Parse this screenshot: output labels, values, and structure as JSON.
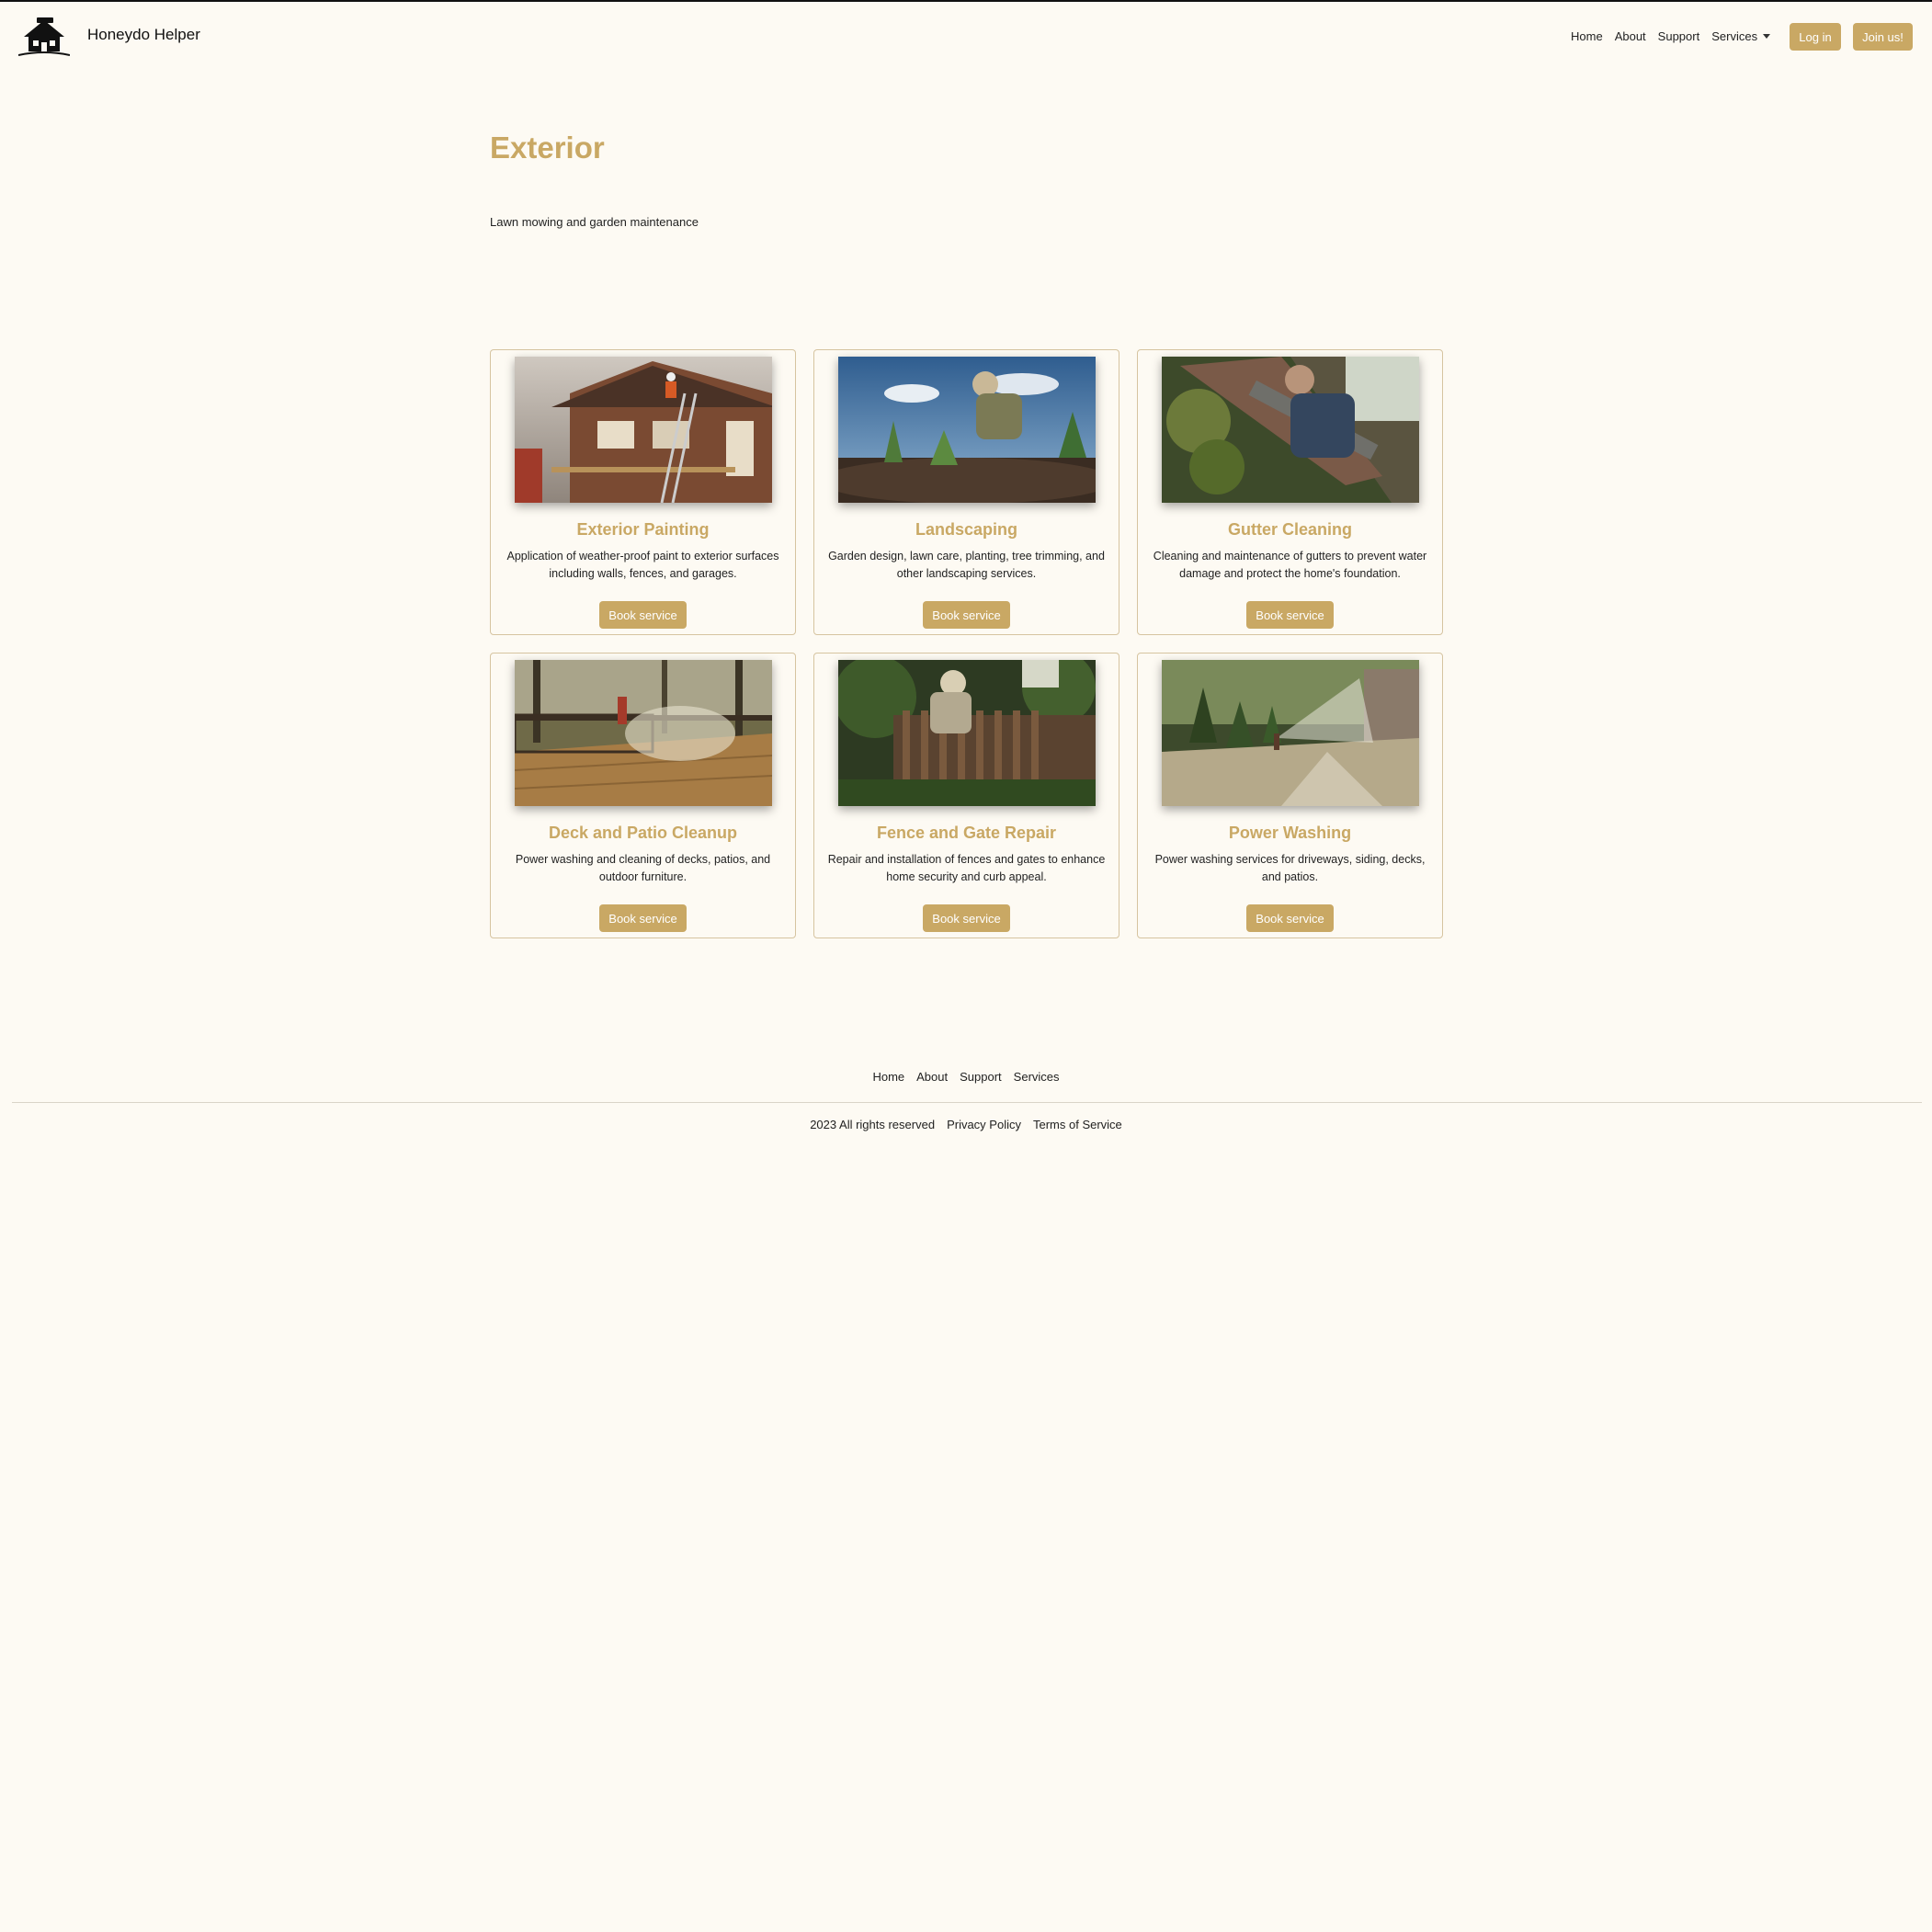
{
  "brand": {
    "name": "Honeydo Helper",
    "logo_icon": "house-with-hammer-icon"
  },
  "nav": {
    "links": [
      "Home",
      "About",
      "Support",
      "Services"
    ],
    "login_label": "Log in",
    "join_label": "Join us!"
  },
  "page": {
    "title": "Exterior",
    "subtitle": "Lawn mowing and garden maintenance"
  },
  "cards": [
    {
      "title": "Exterior Painting",
      "description": "Application of weather-proof paint to exterior surfaces including walls, fences, and garages.",
      "button": "Book service"
    },
    {
      "title": "Landscaping",
      "description": "Garden design, lawn care, planting, tree trimming, and other landscaping services.",
      "button": "Book service"
    },
    {
      "title": "Gutter Cleaning",
      "description": "Cleaning and maintenance of gutters to prevent water damage and protect the home's foundation.",
      "button": "Book service"
    },
    {
      "title": "Deck and Patio Cleanup",
      "description": "Power washing and cleaning of decks, patios, and outdoor furniture.",
      "button": "Book service"
    },
    {
      "title": "Fence and Gate Repair",
      "description": "Repair and installation of fences and gates to enhance home security and curb appeal.",
      "button": "Book service"
    },
    {
      "title": "Power Washing",
      "description": "Power washing services for driveways, siding, decks, and patios.",
      "button": "Book service"
    }
  ],
  "footer": {
    "links": [
      "Home",
      "About",
      "Support",
      "Services"
    ],
    "copyright": "2023 All rights reserved",
    "privacy": "Privacy Policy",
    "terms": "Terms of Service"
  },
  "colors": {
    "accent": "#c9a864",
    "background": "#fdfaf3",
    "card_border": "#d6c4a0"
  }
}
